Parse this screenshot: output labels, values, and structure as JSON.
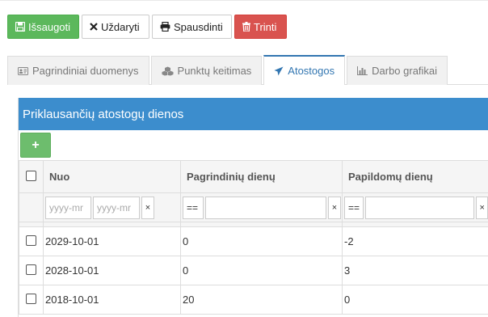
{
  "toolbar": {
    "save_label": "Išsaugoti",
    "close_label": "Uždaryti",
    "print_label": "Spausdinti",
    "delete_label": "Trinti"
  },
  "tabs": [
    {
      "label": "Pagrindiniai duomenys",
      "icon": "id-card-icon"
    },
    {
      "label": "Punktų keitimas",
      "icon": "cubes-icon"
    },
    {
      "label": "Atostogos",
      "icon": "plane-icon",
      "active": true
    },
    {
      "label": "Darbo grafikai",
      "icon": "bar-chart-icon"
    }
  ],
  "panel": {
    "title": "Priklausančių atostogų dienos",
    "add_label": "+"
  },
  "table": {
    "headers": [
      "Nuo",
      "Pagrindinių dienų",
      "Papildomų dienų"
    ],
    "filters": {
      "date_from_placeholder": "yyyy-mr",
      "date_to_placeholder": "yyyy-mr",
      "operator": "==",
      "clear": "×"
    },
    "rows": [
      {
        "nuo": "2029-10-01",
        "pagrindiniu": "0",
        "papildomu": "-2"
      },
      {
        "nuo": "2028-10-01",
        "pagrindiniu": "0",
        "papildomu": "3"
      },
      {
        "nuo": "2018-10-01",
        "pagrindiniu": "20",
        "papildomu": "0"
      }
    ]
  },
  "colors": {
    "success": "#5cb85c",
    "danger": "#d9534f",
    "primary": "#3c8dcd",
    "active_tab": "#3276b1"
  }
}
